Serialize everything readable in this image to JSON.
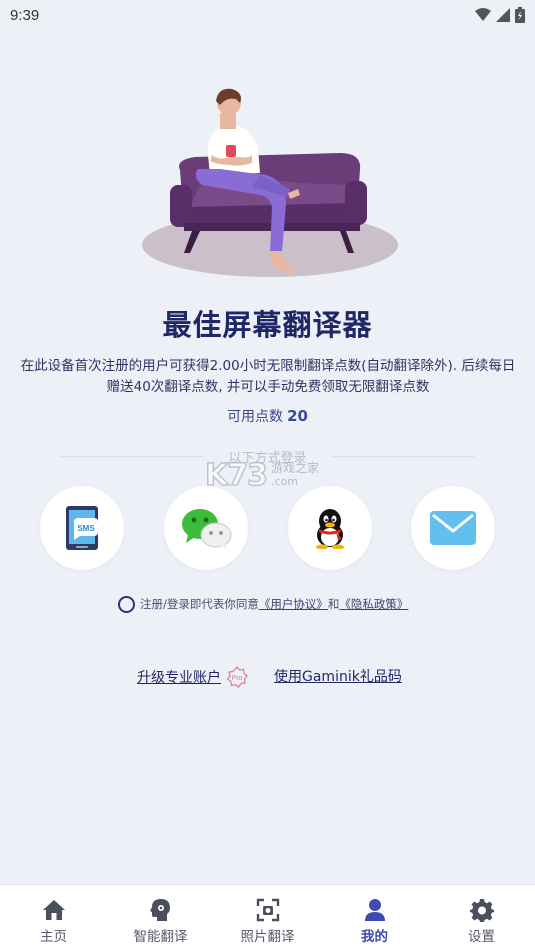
{
  "status": {
    "time": "9:39"
  },
  "hero": {
    "title": "最佳屏幕翻译器"
  },
  "description": "在此设备首次注册的用户可获得2.00小时无限制翻译点数(自动翻译除外). 后续每日赠送40次翻译点数, 并可以手动免费领取无限翻译点数",
  "points": {
    "label": "可用点数",
    "value": "20"
  },
  "login": {
    "divider_text": "以下方式登录",
    "methods": [
      {
        "icon": "sms-phone-icon",
        "label": "SMS"
      },
      {
        "icon": "wechat-icon"
      },
      {
        "icon": "qq-penguin-icon"
      },
      {
        "icon": "mail-icon"
      }
    ]
  },
  "watermark": {
    "brand": "K73",
    "cn": "游戏之家",
    "domain": ".com"
  },
  "agreement": {
    "prefix": "注册/登录即代表你同意",
    "user_agreement": "《用户协议》",
    "and": "和",
    "privacy_policy": "《隐私政策》"
  },
  "links": {
    "upgrade": "升级专业账户",
    "pro_badge": "Pro",
    "gift_code": "使用Gaminik礼品码"
  },
  "tabs": [
    {
      "label": "主页",
      "icon": "home-icon"
    },
    {
      "label": "智能翻译",
      "icon": "brain-icon"
    },
    {
      "label": "照片翻译",
      "icon": "photo-scan-icon"
    },
    {
      "label": "我的",
      "icon": "person-icon",
      "active": true
    },
    {
      "label": "设置",
      "icon": "gear-icon"
    }
  ],
  "colors": {
    "background": "#eef0f7",
    "title": "#1f2766",
    "active_tab": "#3f4bb0",
    "sofa": "#6a3d78"
  }
}
